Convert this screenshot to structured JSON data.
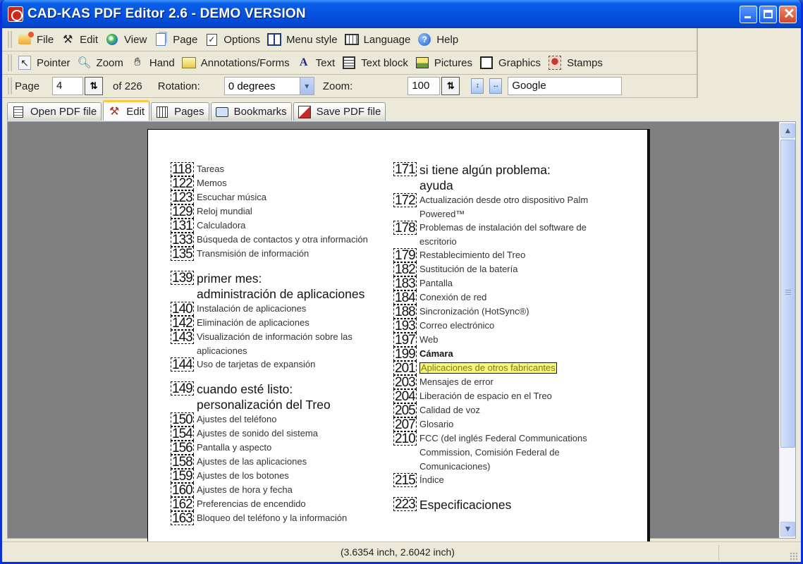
{
  "window": {
    "title": "CAD-KAS PDF Editor 2.6 - DEMO VERSION",
    "controls": {
      "minimize": "minimize",
      "maximize": "maximize",
      "close": "✕"
    }
  },
  "menu_toolbar": {
    "items": [
      {
        "label": "File",
        "icon": "folder-icon"
      },
      {
        "label": "Edit",
        "icon": "tools-icon"
      },
      {
        "label": "View",
        "icon": "globe-icon"
      },
      {
        "label": "Page",
        "icon": "page-icon"
      },
      {
        "label": "Options",
        "icon": "checklist-icon"
      },
      {
        "label": "Menu style",
        "icon": "columns-icon"
      },
      {
        "label": "Language",
        "icon": "book-icon"
      },
      {
        "label": "Help",
        "icon": "help-icon"
      }
    ]
  },
  "tools_toolbar": {
    "items": [
      {
        "label": "Pointer",
        "icon": "pointer-icon"
      },
      {
        "label": "Zoom",
        "icon": "magnifier-icon"
      },
      {
        "label": "Hand",
        "icon": "hand-icon"
      },
      {
        "label": "Annotations/Forms",
        "icon": "annotation-icon"
      },
      {
        "label": "Text",
        "icon": "text-icon"
      },
      {
        "label": "Text block",
        "icon": "text-block-icon"
      },
      {
        "label": "Pictures",
        "icon": "pictures-icon"
      },
      {
        "label": "Graphics",
        "icon": "graphics-icon"
      },
      {
        "label": "Stamps",
        "icon": "stamps-icon"
      }
    ]
  },
  "nav_toolbar": {
    "page_label": "Page",
    "page_value": "4",
    "page_total": "of 226",
    "rotation_label": "Rotation:",
    "rotation_value": "0 degrees",
    "zoom_label": "Zoom:",
    "zoom_value": "100",
    "search_value": "Google",
    "spin_glyph": "⇅",
    "dropdown_glyph": "▾"
  },
  "tabs": [
    {
      "label": "Open PDF file",
      "active": false
    },
    {
      "label": "Edit",
      "active": true
    },
    {
      "label": "Pages",
      "active": false
    },
    {
      "label": "Bookmarks",
      "active": false
    },
    {
      "label": "Save PDF file",
      "active": false
    }
  ],
  "document": {
    "left_column": [
      {
        "num": "118",
        "text": "Tareas"
      },
      {
        "num": "122",
        "text": "Memos"
      },
      {
        "num": "123",
        "text": "Escuchar música"
      },
      {
        "num": "129",
        "text": "Reloj mundial"
      },
      {
        "num": "131",
        "text": "Calculadora"
      },
      {
        "num": "133",
        "text": "Búsqueda de contactos y otra información"
      },
      {
        "num": "135",
        "text": "Transmisión de información"
      },
      {
        "num": "139",
        "text": "primer mes:",
        "text2": "administración de aplicaciones",
        "section": true
      },
      {
        "num": "140",
        "text": "Instalación de aplicaciones"
      },
      {
        "num": "142",
        "text": "Eliminación de aplicaciones"
      },
      {
        "num": "143",
        "text": "Visualización de información sobre las",
        "text2": "aplicaciones"
      },
      {
        "num": "144",
        "text": "Uso de tarjetas de expansión"
      },
      {
        "num": "149",
        "text": "cuando esté listo:",
        "text2": "personalización del Treo",
        "section": true
      },
      {
        "num": "150",
        "text": "Ajustes del teléfono"
      },
      {
        "num": "154",
        "text": "Ajustes de sonido del sistema"
      },
      {
        "num": "156",
        "text": "Pantalla y aspecto"
      },
      {
        "num": "158",
        "text": "Ajustes de las aplicaciones"
      },
      {
        "num": "159",
        "text": "Ajustes de los botones"
      },
      {
        "num": "160",
        "text": "Ajustes de hora y fecha"
      },
      {
        "num": "162",
        "text": "Preferencias de encendido"
      },
      {
        "num": "163",
        "text": "Bloqueo del teléfono y la información"
      }
    ],
    "right_column": [
      {
        "num": "171",
        "text": "si tiene algún problema:",
        "text2": "ayuda",
        "section": true
      },
      {
        "num": "172",
        "text": "Actualización desde otro dispositivo Palm",
        "text2": "Powered™"
      },
      {
        "num": "178",
        "text": "Problemas de instalación del software de",
        "text2": "escritorio"
      },
      {
        "num": "179",
        "text": "Restablecimiento del Treo"
      },
      {
        "num": "182",
        "text": "Sustitución de la batería"
      },
      {
        "num": "183",
        "text": "Pantalla"
      },
      {
        "num": "184",
        "text": "Conexión de red"
      },
      {
        "num": "188",
        "text": "Sincronización (HotSync®)"
      },
      {
        "num": "193",
        "text": "Correo electrónico"
      },
      {
        "num": "197",
        "text": "Web"
      },
      {
        "num": "199",
        "text": "Cámara",
        "bold": true
      },
      {
        "num": "201",
        "text": "Aplicaciones de otros fabricantes",
        "highlight": true
      },
      {
        "num": "203",
        "text": "Mensajes de error"
      },
      {
        "num": "204",
        "text": "Liberación de espacio en el Treo"
      },
      {
        "num": "205",
        "text": "Calidad de voz"
      },
      {
        "num": "207",
        "text": "Glosario"
      },
      {
        "num": "210",
        "text": "FCC (del inglés Federal Communications",
        "text2": "Commission, Comisión Federal de",
        "text3": "Comunicaciones)"
      },
      {
        "num": "215",
        "text": "Índice"
      },
      {
        "num": "223",
        "text": "Especificaciones",
        "section": true
      }
    ],
    "highlight_color": "#f7f77a"
  },
  "status": {
    "coordinates": "(3.6354 inch, 2.6042 inch)"
  },
  "scrollbar": {
    "up_glyph": "▲",
    "down_glyph": "▼"
  }
}
